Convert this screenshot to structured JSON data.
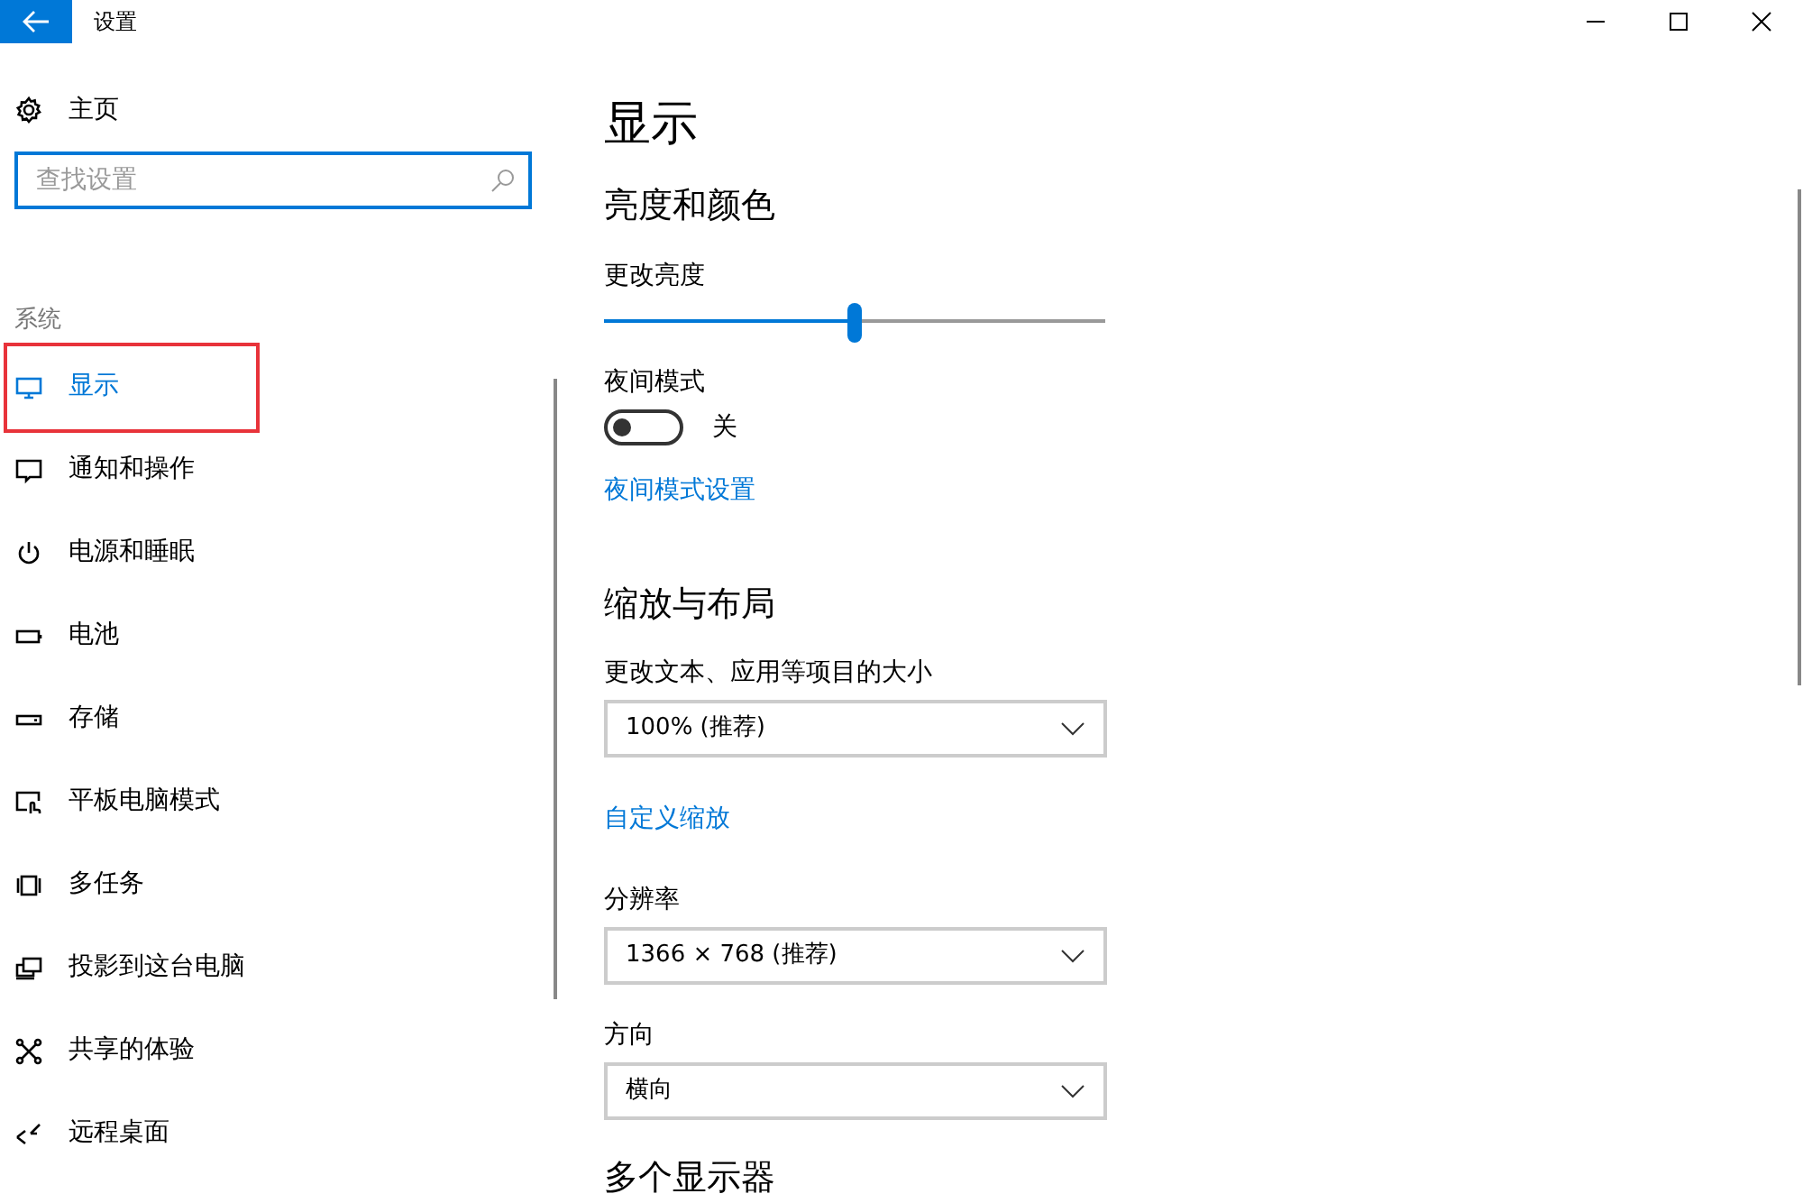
{
  "window": {
    "title": "设置"
  },
  "sidebar": {
    "home": {
      "label": "主页"
    },
    "search": {
      "placeholder": "查找设置"
    },
    "section": "系统",
    "items": [
      {
        "label": "显示",
        "selected": true,
        "highlighted": true
      },
      {
        "label": "通知和操作",
        "selected": false,
        "highlighted": false
      },
      {
        "label": "电源和睡眠",
        "selected": false,
        "highlighted": false
      },
      {
        "label": "电池",
        "selected": false,
        "highlighted": false
      },
      {
        "label": "存储",
        "selected": false,
        "highlighted": false
      },
      {
        "label": "平板电脑模式",
        "selected": false,
        "highlighted": false
      },
      {
        "label": "多任务",
        "selected": false,
        "highlighted": false
      },
      {
        "label": "投影到这台电脑",
        "selected": false,
        "highlighted": false
      },
      {
        "label": "共享的体验",
        "selected": false,
        "highlighted": false
      },
      {
        "label": "远程桌面",
        "selected": false,
        "highlighted": false
      }
    ]
  },
  "main": {
    "title": "显示",
    "sections": [
      {
        "heading": "亮度和颜色",
        "items": [
          {
            "kind": "slider",
            "label": "更改亮度",
            "level": 0.5
          },
          {
            "kind": "toggle",
            "label": "夜间模式",
            "on": false,
            "state_text": "关"
          },
          {
            "kind": "link",
            "label": "夜间模式设置"
          }
        ]
      },
      {
        "heading": "缩放与布局",
        "items": [
          {
            "kind": "dropdown",
            "label": "更改文本、应用等项目的大小",
            "value": "100% (推荐)"
          },
          {
            "kind": "link",
            "label": "自定义缩放"
          },
          {
            "kind": "dropdown",
            "label": "分辨率",
            "value": "1366 × 768 (推荐)"
          },
          {
            "kind": "dropdown",
            "label": "方向",
            "value": "横向"
          }
        ]
      },
      {
        "heading": "多个显示器"
      }
    ]
  }
}
